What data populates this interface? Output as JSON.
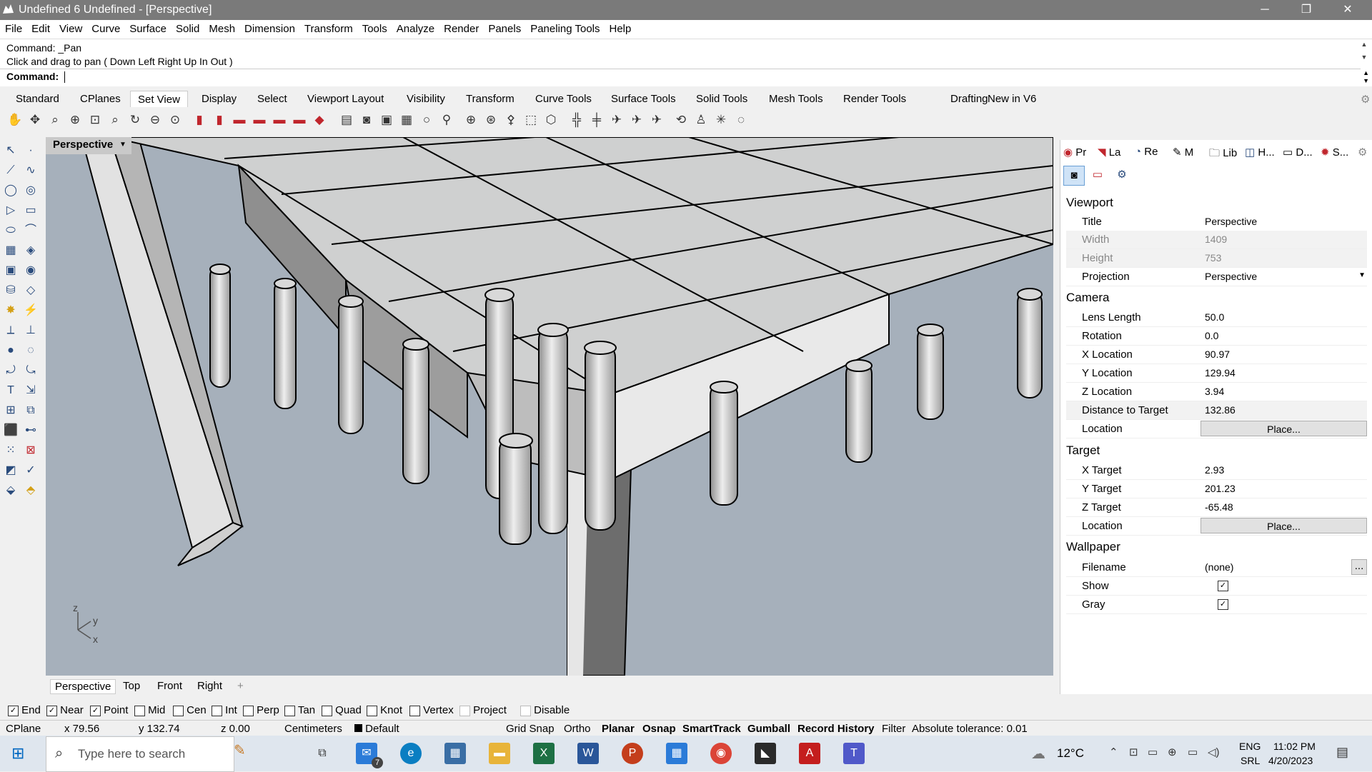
{
  "window": {
    "title": "Undefined 6 Undefined - [Perspective]"
  },
  "menu": [
    "File",
    "Edit",
    "View",
    "Curve",
    "Surface",
    "Solid",
    "Mesh",
    "Dimension",
    "Transform",
    "Tools",
    "Analyze",
    "Render",
    "Panels",
    "Paneling Tools",
    "Help"
  ],
  "command": {
    "history_1": "Command: _Pan",
    "history_2": "Click and drag to pan ( Down  Left  Right  Up  In  Out )",
    "prompt": "Command:"
  },
  "toolbar_tabs": [
    "Standard",
    "CPlanes",
    "Set View",
    "Display",
    "Select",
    "Viewport Layout",
    "Visibility",
    "Transform",
    "Curve Tools",
    "Surface Tools",
    "Solid Tools",
    "Mesh Tools",
    "Render Tools",
    "Drafting",
    "New in V6"
  ],
  "active_toolbar_tab": "Set View",
  "viewport": {
    "label": "Perspective",
    "axis_z": "z",
    "axis_y": "y",
    "axis_x": "x"
  },
  "viewport_tabs": [
    "Perspective",
    "Top",
    "Front",
    "Right"
  ],
  "panel": {
    "tabs": [
      "Pr",
      "La",
      "Re",
      "M",
      "Lib",
      "H...",
      "D...",
      "S..."
    ],
    "sections": {
      "viewport": "Viewport",
      "camera": "Camera",
      "target": "Target",
      "wallpaper": "Wallpaper"
    },
    "viewport_rows": [
      {
        "label": "Title",
        "value": "Perspective"
      },
      {
        "label": "Width",
        "value": "1409"
      },
      {
        "label": "Height",
        "value": "753"
      },
      {
        "label": "Projection",
        "value": "Perspective"
      }
    ],
    "camera_rows": [
      {
        "label": "Lens Length",
        "value": "50.0"
      },
      {
        "label": "Rotation",
        "value": "0.0"
      },
      {
        "label": "X Location",
        "value": "90.97"
      },
      {
        "label": "Y Location",
        "value": "129.94"
      },
      {
        "label": "Z Location",
        "value": "3.94"
      },
      {
        "label": "Distance to Target",
        "value": "132.86"
      },
      {
        "label": "Location",
        "value": "Place..."
      }
    ],
    "target_rows": [
      {
        "label": "X Target",
        "value": "2.93"
      },
      {
        "label": "Y Target",
        "value": "201.23"
      },
      {
        "label": "Z Target",
        "value": "-65.48"
      },
      {
        "label": "Location",
        "value": "Place..."
      }
    ],
    "wallpaper_rows": [
      {
        "label": "Filename",
        "value": "(none)"
      },
      {
        "label": "Show",
        "value": "✓"
      },
      {
        "label": "Gray",
        "value": "✓"
      }
    ],
    "ellipsis": "..."
  },
  "osnaps": [
    {
      "label": "End",
      "checked": true
    },
    {
      "label": "Near",
      "checked": true
    },
    {
      "label": "Point",
      "checked": true
    },
    {
      "label": "Mid",
      "checked": false
    },
    {
      "label": "Cen",
      "checked": false
    },
    {
      "label": "Int",
      "checked": false
    },
    {
      "label": "Perp",
      "checked": false
    },
    {
      "label": "Tan",
      "checked": false
    },
    {
      "label": "Quad",
      "checked": false
    },
    {
      "label": "Knot",
      "checked": false
    },
    {
      "label": "Vertex",
      "checked": false
    },
    {
      "label": "Project",
      "checked": false
    },
    {
      "label": "Disable",
      "checked": false
    }
  ],
  "status": {
    "cplane": "CPlane",
    "x": "x 79.56",
    "y": "y 132.74",
    "z": "z 0.00",
    "units": "Centimeters",
    "layer": "Default",
    "grid_snap": "Grid Snap",
    "ortho": "Ortho",
    "planar": "Planar",
    "osnap": "Osnap",
    "smarttrack": "SmartTrack",
    "gumball": "Gumball",
    "record_history": "Record History",
    "filter": "Filter",
    "tolerance": "Absolute tolerance: 0.01"
  },
  "taskbar": {
    "search_placeholder": "Type here to search",
    "weather": "12°C",
    "lang_1": "ENG",
    "lang_2": "SRL",
    "time": "11:02 PM",
    "date": "4/20/2023",
    "mail_badge": "7"
  },
  "colors": {
    "viewport_bg": "#a6b0bb",
    "taskbar_bg": "#dfe6ee"
  }
}
